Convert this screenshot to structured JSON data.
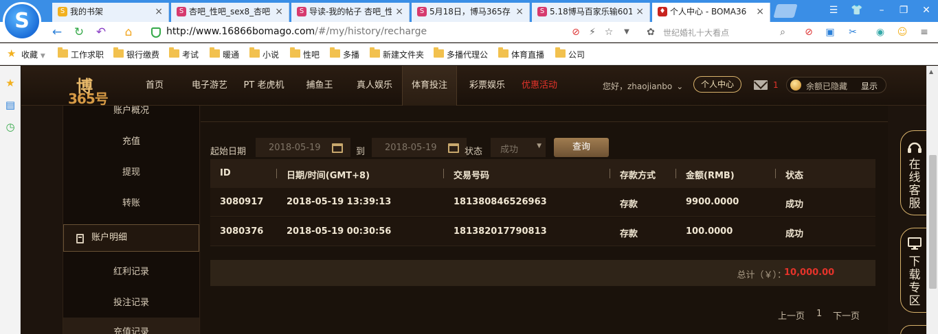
{
  "browser": {
    "tabs": [
      {
        "label": "我的书架",
        "fav": "S",
        "fav_color": "#f2b01e",
        "active": false
      },
      {
        "label": "杏吧_性吧_sex8_杏吧",
        "fav": "S",
        "fav_color": "#d63a6e",
        "active": false
      },
      {
        "label": "导读-我的帖子 杏吧_性",
        "fav": "S",
        "fav_color": "#d63a6e",
        "active": false
      },
      {
        "label": "5月18日，博马365存",
        "fav": "S",
        "fav_color": "#d63a6e",
        "active": false
      },
      {
        "label": "5.18博马百家乐输601",
        "fav": "S",
        "fav_color": "#d63a6e",
        "active": false
      },
      {
        "label": "个人中心 - BOMA36",
        "fav": "♦",
        "fav_color": "#c8241e",
        "active": true
      }
    ],
    "url_host": "http://www.16866bomago.com",
    "url_path": "/#/my/history/recharge",
    "search_hint": "世纪婚礼十大看点",
    "bookmarks": [
      "收藏",
      "工作求职",
      "银行缴费",
      "考试",
      "暖通",
      "小说",
      "性吧",
      "多播",
      "新建文件夹",
      "多播代理公",
      "体育直播",
      "公司"
    ]
  },
  "site": {
    "logo_top": "博",
    "logo_bottom": "365号",
    "nav": [
      "首页",
      "电子游艺",
      "PT 老虎机",
      "捕鱼王",
      "真人娱乐",
      "体育投注",
      "彩票娱乐",
      "优惠活动"
    ],
    "nav_active": "体育投注",
    "greeting": "您好，zhaojianbo",
    "personal_center": "个人中心",
    "mail_count": "1",
    "balance_hidden": "余额已隐藏",
    "show_label": "显示"
  },
  "account_menu": {
    "items_top": [
      "账户概况",
      "充值",
      "提现",
      "转账"
    ],
    "section": "账户明细",
    "items_bottom": [
      "红利记录",
      "投注记录",
      "充值记录"
    ]
  },
  "filter": {
    "start_label": "起始日期",
    "start_date": "2018-05-19",
    "to_label": "到",
    "end_date": "2018-05-19",
    "status_label": "状态",
    "status_value": "成功",
    "query_label": "查询"
  },
  "table": {
    "headers": [
      "ID",
      "日期/时间(GMT+8)",
      "交易号码",
      "存款方式",
      "金额(RMB)",
      "状态"
    ],
    "rows": [
      [
        "3080917",
        "2018-05-19 13:39:13",
        "181380846526963",
        "存款",
        "9900.0000",
        "成功"
      ],
      [
        "3080376",
        "2018-05-19 00:30:56",
        "181382017790813",
        "存款",
        "100.0000",
        "成功"
      ]
    ],
    "total_label": "总计（￥）：",
    "total_value": "10,000.00"
  },
  "pager": {
    "prev": "上一页",
    "page": "1",
    "next": "下一页"
  },
  "float_panel": {
    "service": "在线客服",
    "download": "下载专区"
  },
  "colors": {
    "accent_gold": "#d9b36c",
    "promo_red": "#e5332a",
    "bg_dark": "#1a120b"
  }
}
